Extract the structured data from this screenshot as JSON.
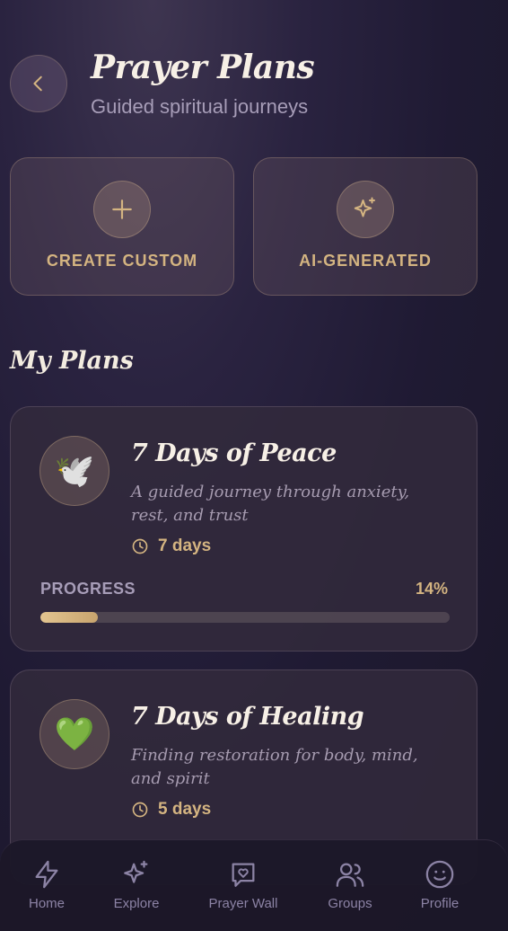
{
  "header": {
    "title": "Prayer Plans",
    "subtitle": "Guided spiritual journeys"
  },
  "actions": [
    {
      "label": "CREATE CUSTOM",
      "icon": "plus-icon"
    },
    {
      "label": "AI-GENERATED",
      "icon": "sparkle-icon"
    }
  ],
  "section": {
    "title": "My Plans"
  },
  "plans": [
    {
      "icon": "🕊️",
      "title": "7 Days of Peace",
      "description": "A guided journey through anxiety, rest, and trust",
      "duration": "7 days",
      "progress_label": "PROGRESS",
      "progress_text": "14%",
      "progress": 0.14
    },
    {
      "icon": "💚",
      "title": "7 Days of Healing",
      "description": "Finding restoration for body, mind, and spirit",
      "duration": "5 days"
    }
  ],
  "tabbar": [
    {
      "label": "Home",
      "icon": "bolt-icon"
    },
    {
      "label": "Explore",
      "icon": "sparkles-icon"
    },
    {
      "label": "Prayer Wall",
      "icon": "heart-message-icon"
    },
    {
      "label": "Groups",
      "icon": "users-icon"
    },
    {
      "label": "Profile",
      "icon": "smiley-icon"
    }
  ],
  "colors": {
    "accent": "#d4b481",
    "muted": "#a79db8",
    "background": "#1f1a33"
  }
}
